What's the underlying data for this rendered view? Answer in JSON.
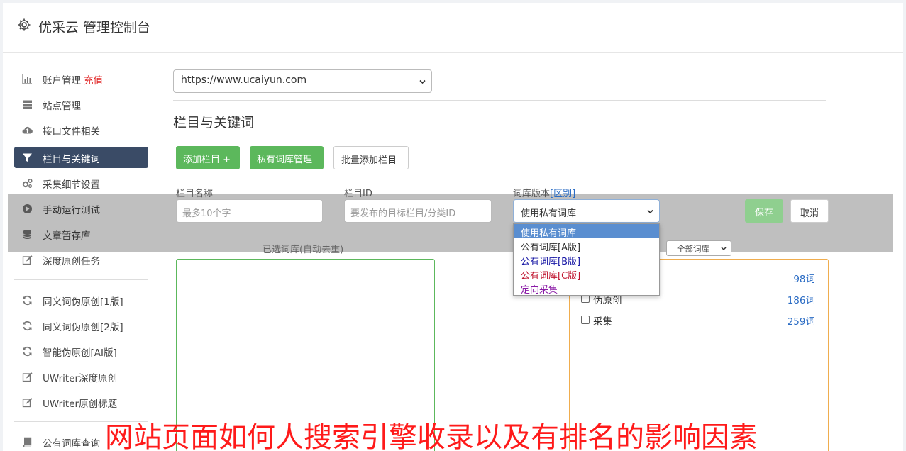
{
  "header": {
    "title": "优采云 管理控制台"
  },
  "sidebar": {
    "items": [
      {
        "label": "账户管理",
        "badge": "充值",
        "icon": "bar-chart-icon"
      },
      {
        "label": "站点管理",
        "icon": "server-icon"
      },
      {
        "label": "接口文件相关",
        "icon": "cloud-upload-icon"
      },
      {
        "label": "栏目与关键词",
        "icon": "filter-icon",
        "active": true
      },
      {
        "label": "采集细节设置",
        "icon": "cogs-icon"
      },
      {
        "label": "手动运行测试",
        "icon": "play-circle-icon"
      },
      {
        "label": "文章暂存库",
        "icon": "database-icon"
      },
      {
        "label": "深度原创任务",
        "icon": "edit-icon"
      },
      {
        "label": "同义词伪原创[1版]",
        "icon": "refresh-icon"
      },
      {
        "label": "同义词伪原创[2版]",
        "icon": "refresh-icon"
      },
      {
        "label": "智能伪原创[AI版]",
        "icon": "refresh-icon"
      },
      {
        "label": "UWriter深度原创",
        "icon": "edit-icon"
      },
      {
        "label": "UWriter原创标题",
        "icon": "edit-icon"
      },
      {
        "label": "公有词库查询",
        "icon": "book-icon"
      }
    ]
  },
  "main": {
    "site_select": {
      "value": "https://www.ucaiyun.com"
    },
    "section_title": "栏目与关键词",
    "buttons": {
      "add_column": "添加栏目 +",
      "private_lib": "私有词库管理",
      "batch_add": "批量添加栏目"
    },
    "form": {
      "name_label": "栏目名称",
      "name_placeholder": "最多10个字",
      "id_label": "栏目ID",
      "id_placeholder": "要发布的目标栏目/分类ID",
      "version_label": "词库版本",
      "version_link": "[区别]",
      "version_value": "使用私有词库",
      "save": "保存",
      "cancel": "取消"
    },
    "dropdown_options": [
      {
        "label": "使用私有词库",
        "color": "#ffffff",
        "highlighted": true
      },
      {
        "label": "公有词库[A版]",
        "color": "#333333"
      },
      {
        "label": "公有词库[B版]",
        "color": "#1a1aa6"
      },
      {
        "label": "公有词库[C版]",
        "color": "#c0152f"
      },
      {
        "label": "定向采集",
        "color": "#8a1aa6"
      }
    ],
    "selected_label": "已选词库(自动去重)",
    "library_filter": "全部词库",
    "libraries": [
      {
        "name": "",
        "count": "98词"
      },
      {
        "name": "伪原创",
        "count": "186词"
      },
      {
        "name": "采集",
        "count": "259词"
      }
    ]
  },
  "watermark": "网站页面如何人搜索引擎收录以及有排名的影响因素",
  "colors": {
    "accent_green": "#5cb85c",
    "nav_active": "#3a4b66",
    "link_blue": "#2b6cc4",
    "badge_red": "#e02020",
    "box_orange": "#f0ad4e"
  }
}
